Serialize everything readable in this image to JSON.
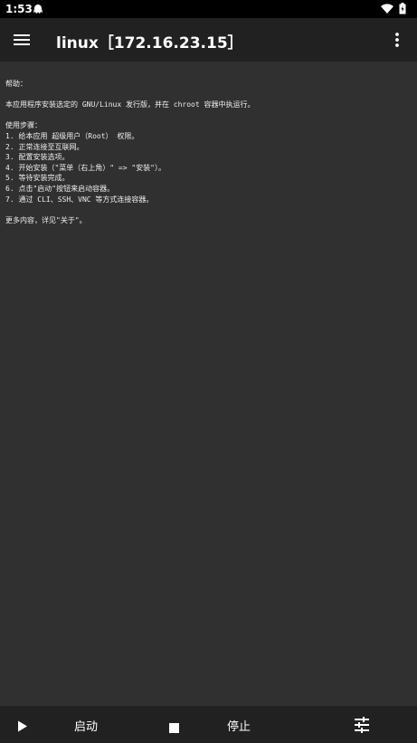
{
  "status_bar": {
    "time": "1:53"
  },
  "app_bar": {
    "title": "linux［172.16.23.15］"
  },
  "output": {
    "lines": [
      "帮助：",
      "",
      "本应用程序安装选定的 GNU/Linux 发行版，并在 chroot 容器中执运行。",
      "",
      "使用步骤：",
      "1. 给本应用 超级用户（Root） 权限。",
      "2. 正常连接至互联网。",
      "3. 配置安装选项。",
      "4. 开始安装（\"菜单（右上角）\" => \"安装\"）。",
      "5. 等待安装完成。",
      "6. 点击\"启动\"按钮来启动容器。",
      "7. 通过 CLI、SSH、VNC 等方式连接容器。",
      "",
      "更多内容，详见\"关于\"。"
    ]
  },
  "bottom_bar": {
    "start_label": "启动",
    "stop_label": "停止"
  },
  "icons": {
    "menu": "hamburger-menu-icon",
    "overflow": "more-vert-icon",
    "start": "play-icon",
    "stop": "stop-icon",
    "settings": "tune-sliders-icon"
  },
  "colors": {
    "status_bar": "#000000",
    "app_bar": "#212121",
    "background": "#303030",
    "bottom_bar": "#212121",
    "text": "#ffffff"
  }
}
